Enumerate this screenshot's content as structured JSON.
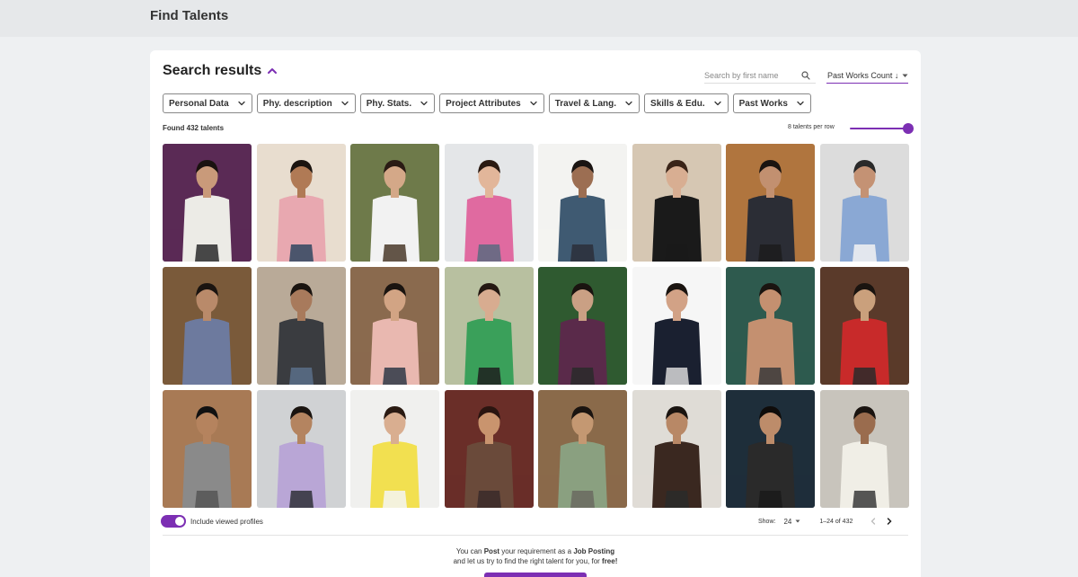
{
  "header": {
    "title": "Find Talents"
  },
  "search": {
    "title": "Search results",
    "placeholder": "Search by first name",
    "sort_label": "Past Works Count ↓"
  },
  "filters": [
    "Personal Data",
    "Phy. description",
    "Phy. Stats.",
    "Project Attributes",
    "Travel & Lang.",
    "Skills & Edu.",
    "Past Works"
  ],
  "results": {
    "found_text": "Found 432 talents",
    "per_row_text": "8 talents per row",
    "per_row_value": 8
  },
  "talents": [
    {
      "bg": "#5a2a55",
      "skin": "#c99a7a",
      "hair": "#1a1210",
      "shirt": "#ecebe6",
      "pants": "#2a2a2a"
    },
    {
      "bg": "#e8ddcf",
      "skin": "#b07a55",
      "hair": "#1b1410",
      "shirt": "#e8a8b0",
      "pants": "#2f4660"
    },
    {
      "bg": "#6e7a4a",
      "skin": "#d4a888",
      "hair": "#2a1b14",
      "shirt": "#f2f2f2",
      "pants": "#4a3a2a"
    },
    {
      "bg": "#e4e6e8",
      "skin": "#e2b69a",
      "hair": "#2a1a12",
      "shirt": "#e06aa0",
      "pants": "#5a6a80"
    },
    {
      "bg": "#f3f3f1",
      "skin": "#9c6e52",
      "hair": "#1a1412",
      "shirt": "#3f5a72",
      "pants": "#2b2f3a"
    },
    {
      "bg": "#d6c7b3",
      "skin": "#d8ae92",
      "hair": "#3a2418",
      "shirt": "#1a1a1a",
      "pants": "#1a1a1a"
    },
    {
      "bg": "#b0753e",
      "skin": "#c29070",
      "hair": "#1a1410",
      "shirt": "#2b2d35",
      "pants": "#1c1c1c"
    },
    {
      "bg": "#dcdcdc",
      "skin": "#c49274",
      "hair": "#2a2a2a",
      "shirt": "#8aa8d4",
      "pants": "#f2f2f2"
    },
    {
      "bg": "#7a5a3a",
      "skin": "#b98a6a",
      "hair": "#1a1410",
      "shirt": "#6d7a9e",
      "pants": "#6d7a9e"
    },
    {
      "bg": "#b9aa98",
      "skin": "#a87a5c",
      "hair": "#1a1410",
      "shirt": "#3a3c40",
      "pants": "#5a6f8a"
    },
    {
      "bg": "#8a6a4e",
      "skin": "#d2a484",
      "hair": "#1a1410",
      "shirt": "#e9b8b0",
      "pants": "#2f3848"
    },
    {
      "bg": "#b8c0a0",
      "skin": "#d8ac90",
      "hair": "#241812",
      "shirt": "#3aa05a",
      "pants": "#1f1f1f"
    },
    {
      "bg": "#2f5a30",
      "skin": "#caa084",
      "hair": "#1a1410",
      "shirt": "#5a2a4a",
      "pants": "#2a2a2a"
    },
    {
      "bg": "#f6f6f6",
      "skin": "#d2a286",
      "hair": "#1a1410",
      "shirt": "#1a2030",
      "pants": "#d8d8d8"
    },
    {
      "bg": "#2e5a4e",
      "skin": "#c49070",
      "hair": "#1a1410",
      "shirt": "#c49070",
      "pants": "#3a3a3a"
    },
    {
      "bg": "#5a3a2a",
      "skin": "#caa07c",
      "hair": "#1a1410",
      "shirt": "#c82a2a",
      "pants": "#2a2a2a"
    },
    {
      "bg": "#a87a55",
      "skin": "#b5835e",
      "hair": "#111111",
      "shirt": "#8a8a8a",
      "pants": "#555555"
    },
    {
      "bg": "#d0d2d4",
      "skin": "#b48460",
      "hair": "#1a1410",
      "shirt": "#b9a6d6",
      "pants": "#2f3038"
    },
    {
      "bg": "#f0f0ee",
      "skin": "#d9ae90",
      "hair": "#2a1a12",
      "shirt": "#f2e050",
      "pants": "#f4f4f4"
    },
    {
      "bg": "#6a2e28",
      "skin": "#c9946e",
      "hair": "#2a1510",
      "shirt": "#6a4a3a",
      "pants": "#3a2a2a"
    },
    {
      "bg": "#8a6a4a",
      "skin": "#c49872",
      "hair": "#1a1410",
      "shirt": "#8aa080",
      "pants": "#6a6a60"
    },
    {
      "bg": "#dfdcd6",
      "skin": "#b88866",
      "hair": "#1a1410",
      "shirt": "#3a2820",
      "pants": "#2a2a2a"
    },
    {
      "bg": "#1e2e3a",
      "skin": "#bd8c6a",
      "hair": "#0f0c0a",
      "shirt": "#2a2a2a",
      "pants": "#1a1a1a"
    },
    {
      "bg": "#c8c4bc",
      "skin": "#9a6c4e",
      "hair": "#1a1410",
      "shirt": "#f0eee6",
      "pants": "#3a3a3a"
    }
  ],
  "bottom": {
    "toggle_label": "Include viewed profiles",
    "toggle_on": true,
    "show_label": "Show:",
    "per_page": "24",
    "range_text": "1–24 of 432"
  },
  "footer": {
    "line1_a": "You can ",
    "line1_b": "Post",
    "line1_c": " your requirement as a ",
    "line1_d": "Job Posting",
    "line2_a": "and let us try to find the right talent for you, for ",
    "line2_b": "free!"
  },
  "colors": {
    "accent": "#7c2fb3"
  }
}
